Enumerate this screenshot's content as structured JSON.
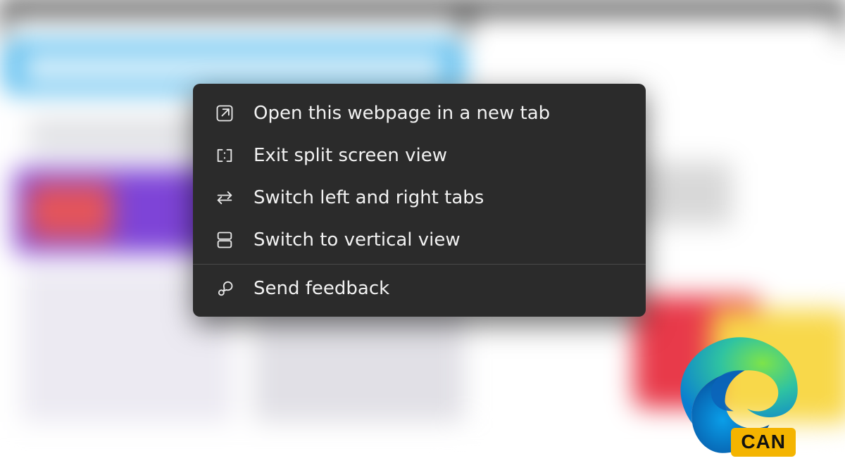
{
  "menu": {
    "items": [
      {
        "icon": "open-new-tab-icon",
        "label": "Open this webpage in a new tab"
      },
      {
        "icon": "exit-split-icon",
        "label": "Exit split screen view"
      },
      {
        "icon": "switch-tabs-icon",
        "label": "Switch left and right tabs"
      },
      {
        "icon": "vertical-view-icon",
        "label": "Switch to vertical view"
      }
    ],
    "footer": {
      "icon": "send-feedback-icon",
      "label": "Send feedback"
    }
  },
  "logo": {
    "name": "edge-canary-logo",
    "badge": "CAN"
  }
}
